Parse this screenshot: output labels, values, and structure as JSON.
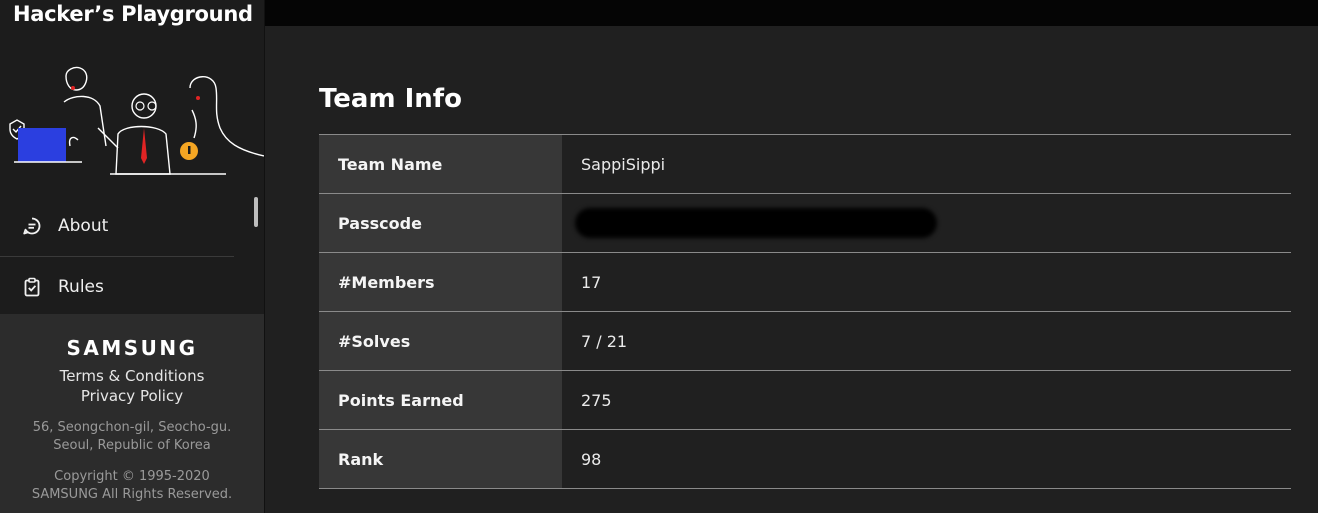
{
  "brand": {
    "title": "Hacker’s Playground"
  },
  "nav": {
    "items": [
      {
        "label": "About",
        "icon": "chat-bubble-icon"
      },
      {
        "label": "Rules",
        "icon": "clipboard-check-icon"
      }
    ]
  },
  "footer": {
    "logo": "SAMSUNG",
    "terms": "Terms & Conditions",
    "privacy": "Privacy Policy",
    "address_line1": "56, Seongchon-gil, Seocho-gu.",
    "address_line2": "Seoul, Republic of Korea",
    "copyright_line1": "Copyright © 1995-2020",
    "copyright_line2": "SAMSUNG All Rights Reserved."
  },
  "main": {
    "title": "Team Info",
    "rows": [
      {
        "key": "Team Name",
        "value": "SappiSippi"
      },
      {
        "key": "Passcode",
        "value": ""
      },
      {
        "key": "#Members",
        "value": "17"
      },
      {
        "key": "#Solves",
        "value": "7 / 21"
      },
      {
        "key": "Points Earned",
        "value": "275"
      },
      {
        "key": "Rank",
        "value": "98"
      }
    ]
  },
  "colors": {
    "sidebar": "#1c1c1c",
    "footer": "#2c2c2c",
    "content": "#202020",
    "key_cell": "#373737",
    "accent_blue": "#2b3fe0",
    "accent_red": "#e02424",
    "accent_orange": "#f5a623"
  }
}
